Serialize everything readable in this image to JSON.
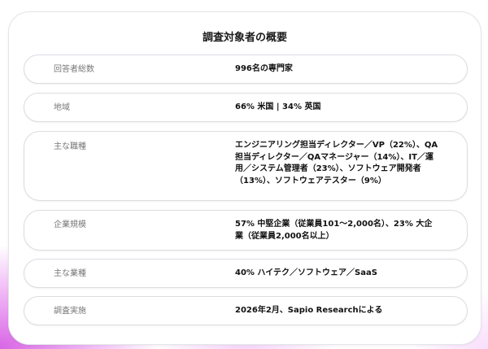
{
  "title": "調査対象者の概要",
  "rows": [
    {
      "label": "回答者総数",
      "value": "996名の専門家"
    },
    {
      "label": "地域",
      "value": "66% 米国 | 34% 英国"
    },
    {
      "label": "主な職種",
      "value": "エンジニアリング担当ディレクター／VP（22%）、QA担当ディレクター／QAマネージャー（14%）、IT／運用／システム管理者（23%）、ソフトウェア開発者（13%）、ソフトウェアテスター（9%）"
    },
    {
      "label": "企業規模",
      "value": "57% 中堅企業（従業員101〜2,000名）、23% 大企業（従業員2,000名以上）"
    },
    {
      "label": "主な業種",
      "value": "40% ハイテク／ソフトウェア／SaaS"
    },
    {
      "label": "調査実施",
      "value": "2026年2月、Sapio Researchによる"
    }
  ]
}
